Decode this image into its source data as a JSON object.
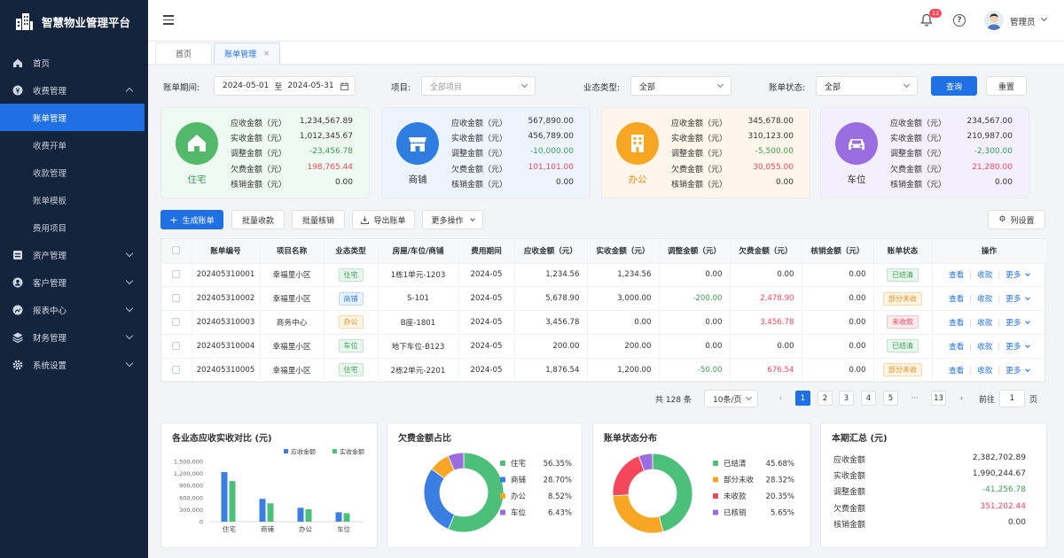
{
  "app": {
    "title": "智慧物业管理平台"
  },
  "sidebar": {
    "items": [
      {
        "label": "首页",
        "icon": "home-icon"
      },
      {
        "label": "收费管理",
        "icon": "fee-icon",
        "expanded": true,
        "children": [
          "账单管理",
          "收费开单",
          "收款管理",
          "账单模板",
          "费用项目"
        ],
        "active_child": "账单管理"
      },
      {
        "label": "资产管理",
        "icon": "asset-icon"
      },
      {
        "label": "客户管理",
        "icon": "customer-icon"
      },
      {
        "label": "报表中心",
        "icon": "report-icon"
      },
      {
        "label": "财务管理",
        "icon": "finance-icon"
      },
      {
        "label": "系统设置",
        "icon": "settings-icon"
      }
    ]
  },
  "header": {
    "notification_count": "12",
    "user_name": "管理员"
  },
  "tabs": [
    {
      "label": "首页"
    },
    {
      "label": "账单管理",
      "active": true
    }
  ],
  "filters": {
    "period_label": "账单期间:",
    "date_start": "2024-05-01",
    "date_sep": "至",
    "date_end": "2024-05-31",
    "project_label": "项目:",
    "project_placeholder": "全部项目",
    "biz_label": "业态类型:",
    "biz_value": "全部",
    "status_label": "账单状态:",
    "status_value": "全部",
    "query_button": "查询",
    "reset_button": "重置"
  },
  "summary_labels": [
    "应收金额（元）",
    "实收金额（元）",
    "调整金额（元）",
    "欠费金额（元）",
    "核销金额（元）"
  ],
  "cards": [
    {
      "name": "住宅",
      "color": "#52b96b",
      "bg": "#eefaf1",
      "name_color": "#3a9f53",
      "values": [
        "1,234,567.89",
        "1,012,345.67",
        "-23,456.78",
        "198,765.44",
        "0.00"
      ]
    },
    {
      "name": "商铺",
      "color": "#2f7de1",
      "bg": "#edf4fe",
      "name_color": "#333333",
      "values": [
        "567,890.00",
        "456,789.00",
        "-10,000.00",
        "101,101.00",
        "0.00"
      ]
    },
    {
      "name": "办公",
      "color": "#f6a623",
      "bg": "#fef6ea",
      "name_color": "#e58d0e",
      "values": [
        "345,678.00",
        "310,123.00",
        "-5,500.00",
        "30,055.00",
        "0.00"
      ]
    },
    {
      "name": "车位",
      "color": "#9a6de0",
      "bg": "#f4effd",
      "name_color": "#333333",
      "values": [
        "234,567.00",
        "210,987.00",
        "-2,300.00",
        "21,280.00",
        "0.00"
      ]
    }
  ],
  "toolbar": {
    "generate": "生成账单",
    "batch_collect": "批量收款",
    "batch_writeoff": "批量核销",
    "export": "导出账单",
    "more": "更多操作",
    "columns": "列设置"
  },
  "table": {
    "headers": [
      "账单编号",
      "项目名称",
      "业态类型",
      "房屋/车位/商铺",
      "费用期间",
      "应收金额（元）",
      "实收金额（元）",
      "调整金额（元）",
      "欠费金额（元）",
      "核销金额（元）",
      "账单状态",
      "操作"
    ],
    "rows": [
      {
        "id": "202405310001",
        "project": "幸福里小区",
        "type": "住宅",
        "unit": "1栋1单元-1203",
        "period": "2024-05",
        "due": "1,234.56",
        "paid": "1,234.56",
        "adjust": "0.00",
        "owed": "0.00",
        "writeoff": "0.00",
        "status": "已结清"
      },
      {
        "id": "202405310002",
        "project": "幸福里小区",
        "type": "商铺",
        "unit": "S-101",
        "period": "2024-05",
        "due": "5,678.90",
        "paid": "3,000.00",
        "adjust": "-200.00",
        "owed": "2,478.90",
        "writeoff": "0.00",
        "status": "部分未收"
      },
      {
        "id": "202405310003",
        "project": "商务中心",
        "type": "办公",
        "unit": "B座-1801",
        "period": "2024-05",
        "due": "3,456.78",
        "paid": "0.00",
        "adjust": "0.00",
        "owed": "3,456.78",
        "writeoff": "0.00",
        "status": "未收款"
      },
      {
        "id": "202405310004",
        "project": "幸福里小区",
        "type": "车位",
        "unit": "地下车位-B123",
        "period": "2024-05",
        "due": "200.00",
        "paid": "200.00",
        "adjust": "0.00",
        "owed": "0.00",
        "writeoff": "0.00",
        "status": "已结清"
      },
      {
        "id": "202405310005",
        "project": "幸福里小区",
        "type": "住宅",
        "unit": "2栋2单元-2201",
        "period": "2024-05",
        "due": "1,876.54",
        "paid": "1,200.00",
        "adjust": "-50.00",
        "owed": "676.54",
        "writeoff": "0.00",
        "status": "部分未收"
      }
    ],
    "actions": [
      "查看",
      "收款",
      "更多"
    ]
  },
  "pagination": {
    "total_text": "共 128 条",
    "page_size": "10条/页",
    "pages": [
      "1",
      "2",
      "3",
      "4",
      "5"
    ],
    "ellipsis": "···",
    "last_page": "13",
    "goto_label": "前往",
    "goto_value": "1",
    "page_unit": "页",
    "current": "1"
  },
  "chart_titles": {
    "bar": "各业态应收实收对比 (元)",
    "owed_pie": "欠费金额占比",
    "status_pie": "账单状态分布",
    "totals": "本期汇总 (元)"
  },
  "chart_data": [
    {
      "type": "bar",
      "title": "各业态应收实收对比 (元)",
      "categories": [
        "住宅",
        "商铺",
        "办公",
        "车位"
      ],
      "series": [
        {
          "name": "应收金额",
          "color": "#3a7ee2",
          "values": [
            1234567.89,
            567890.0,
            345678.0,
            234567.0
          ]
        },
        {
          "name": "实收金额",
          "color": "#4cbf7a",
          "values": [
            1012345.67,
            456789.0,
            310123.0,
            210987.0
          ]
        }
      ],
      "yticks": [
        "1,500,000",
        "1,200,000",
        "900,000",
        "600,000",
        "300,000",
        "0"
      ],
      "ylim": [
        0,
        1500000
      ],
      "legend": "top-right"
    },
    {
      "type": "pie",
      "title": "欠费金额占比",
      "labels": [
        "住宅",
        "商铺",
        "办公",
        "车位"
      ],
      "values": [
        56.35,
        28.7,
        8.52,
        6.43
      ],
      "display": [
        "56.35%",
        "28.70%",
        "8.52%",
        "6.43%"
      ],
      "colors": [
        "#4cbf7a",
        "#3a7ee2",
        "#f6a623",
        "#9a6de0"
      ]
    },
    {
      "type": "pie",
      "title": "账单状态分布",
      "labels": [
        "已结清",
        "部分未收",
        "未收款",
        "已核销"
      ],
      "values": [
        45.68,
        28.32,
        20.35,
        5.65
      ],
      "display": [
        "45.68%",
        "28.32%",
        "20.35%",
        "5.65%"
      ],
      "colors": [
        "#4cbf7a",
        "#f6a623",
        "#f5475a",
        "#9a6de0"
      ]
    }
  ],
  "totals": [
    {
      "label": "应收金额",
      "value": "2,382,702.89",
      "color": "#333333"
    },
    {
      "label": "实收金额",
      "value": "1,990,244.67",
      "color": "#333333"
    },
    {
      "label": "调整金额",
      "value": "-41,256.78",
      "color": "#3a9f53"
    },
    {
      "label": "欠费金额",
      "value": "351,202.44",
      "color": "#f5475a"
    },
    {
      "label": "核销金额",
      "value": "0.00",
      "color": "#333333"
    }
  ],
  "colors": {
    "accent": "#1f6fe5",
    "sidebar": "#14243d",
    "danger": "#f5475a",
    "success": "#3a9f53"
  }
}
